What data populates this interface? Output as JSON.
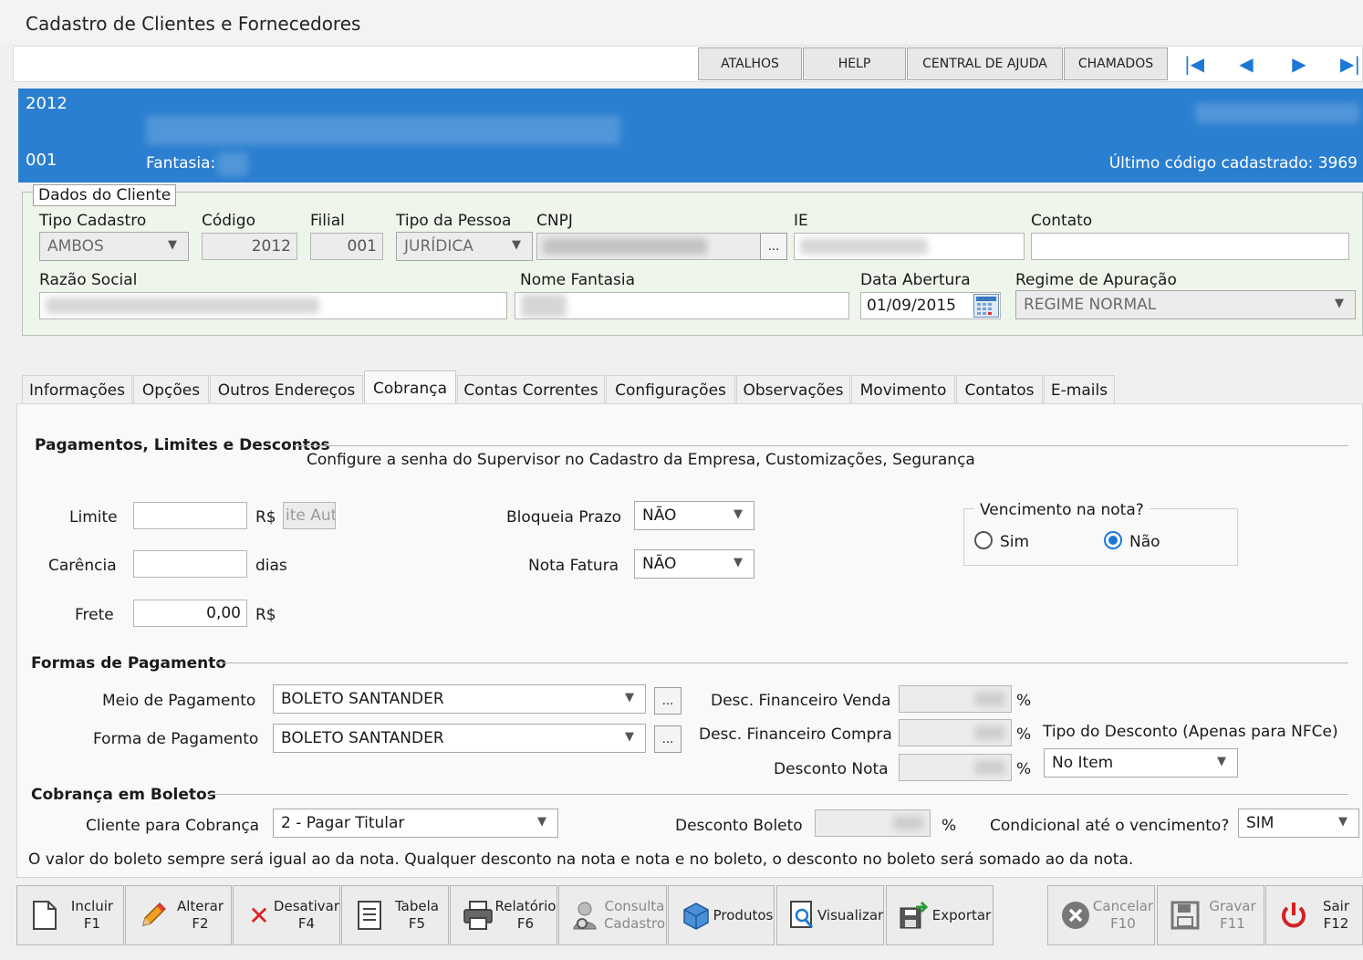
{
  "window": {
    "title": "Cadastro de Clientes e Fornecedores"
  },
  "toolbar": {
    "atalhos": "ATALHOS",
    "help": "HELP",
    "central": "CENTRAL DE AJUDA",
    "chamados": "CHAMADOS",
    "icons": [
      "first-record-icon",
      "previous-record-icon",
      "next-record-icon",
      "last-record-icon"
    ]
  },
  "banner": {
    "code": "2012",
    "branch": "001",
    "fantasia_label": "Fantasia:",
    "last_code": "Último código cadastrado: 3969",
    "color": "#2b7fd0"
  },
  "client": {
    "legend": "Dados do Cliente",
    "tipo_cadastro_label": "Tipo Cadastro",
    "tipo_cadastro": "AMBOS",
    "codigo_label": "Código",
    "codigo": "2012",
    "filial_label": "Filial",
    "filial": "001",
    "tipo_pessoa_label": "Tipo da Pessoa",
    "tipo_pessoa": "JURÍDICA",
    "cnpj_label": "CNPJ",
    "cnpj_btn": "...",
    "ie_label": "IE",
    "contato_label": "Contato",
    "razao_label": "Razão Social",
    "fantasia_label": "Nome Fantasia",
    "data_abertura_label": "Data Abertura",
    "data_abertura": "01/09/2015",
    "regime_label": "Regime de Apuração",
    "regime": "REGIME NORMAL"
  },
  "tabs": [
    "Informações",
    "Opções",
    "Outros Endereços",
    "Cobrança",
    "Contas Correntes",
    "Configurações",
    "Observações",
    "Movimento",
    "Contatos",
    "E-mails"
  ],
  "cobranca": {
    "section1": "Pagamentos, Limites e Descontos",
    "hint": "Configure a senha do Supervisor no Cadastro da Empresa, Customizações, Segurança",
    "limite_label": "Limite",
    "limite_unit": "R$",
    "limite_auto": "ite Aut",
    "carencia_label": "Carência",
    "carencia_unit": "dias",
    "frete_label": "Frete",
    "frete": "0,00",
    "frete_unit": "R$",
    "bloqueia_label": "Bloqueia Prazo",
    "bloqueia": "NÃO",
    "nota_fatura_label": "Nota Fatura",
    "nota_fatura": "NÃO",
    "vencimento_label": "Vencimento na nota?",
    "sim": "Sim",
    "nao": "Não",
    "section2": "Formas de Pagamento",
    "meio_label": "Meio de Pagamento",
    "meio": "BOLETO SANTANDER",
    "forma_label": "Forma de Pagamento",
    "forma": "BOLETO SANTANDER",
    "dots": "...",
    "desc_venda_label": "Desc. Financeiro Venda",
    "desc_compra_label": "Desc. Financeiro Compra",
    "desc_nota_label": "Desconto Nota",
    "pct": "%",
    "tipo_desc_label": "Tipo do Desconto (Apenas para NFCe)",
    "tipo_desc": "No Item",
    "section3": "Cobrança em Boletos",
    "cliente_cobranca_label": "Cliente para Cobrança",
    "cliente_cobranca": "2 - Pagar Titular",
    "desc_boleto_label": "Desconto Boleto",
    "condicional_label": "Condicional até o vencimento?",
    "condicional": "SIM",
    "note": "O valor do boleto sempre será igual ao da nota.  Qualquer desconto na nota e nota e no boleto, o desconto no boleto será somado ao da nota."
  },
  "buttons": {
    "incluir": [
      "Incluir",
      "F1"
    ],
    "alterar": [
      "Alterar",
      "F2"
    ],
    "desativar": [
      "Desativar",
      "F4"
    ],
    "tabela": [
      "Tabela",
      "F5"
    ],
    "relatorio": [
      "Relatório",
      "F6"
    ],
    "consulta": [
      "Consulta",
      "Cadastro"
    ],
    "produtos": "Produtos",
    "visualizar": "Visualizar",
    "exportar": "Exportar",
    "cancelar": [
      "Cancelar",
      "F10"
    ],
    "gravar": [
      "Gravar",
      "F11"
    ],
    "sair": [
      "Sair",
      "F12"
    ]
  }
}
